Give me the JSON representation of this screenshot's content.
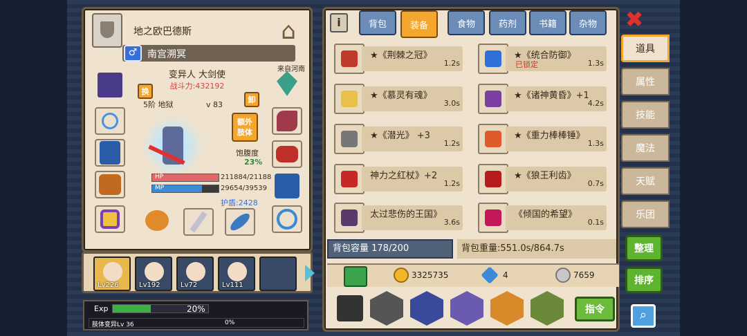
{
  "character": {
    "guild_name": "地之欧巴德斯",
    "gender_symbol": "♂",
    "name": "南宫溯冥",
    "origin": "来自河南",
    "class_line": "变异人 大剑使",
    "power_label": "战斗力:",
    "power_value": "432192",
    "swap_button": "换",
    "unequip_button": "卸",
    "extra_limb_button": "额外\n肢体",
    "stage_text": "5阶 地狱",
    "level_text": "v 83",
    "hunger_label": "饱腹度",
    "hunger_value": "23%",
    "hp_label": "HP",
    "hp_value": "211884/21188",
    "hp_fill": 1.0,
    "mp_label": "MP",
    "mp_value": "29654/39539",
    "mp_fill": 0.75,
    "shield_text": "护盾:2428"
  },
  "party": [
    {
      "level": "Lv226",
      "selected": true
    },
    {
      "level": "Lv192",
      "selected": false
    },
    {
      "level": "Lv72",
      "selected": false
    },
    {
      "level": "Lv111",
      "selected": false
    },
    {
      "level": "",
      "selected": false
    }
  ],
  "exp": {
    "label": "Exp",
    "percent": "20%",
    "fill": 0.4,
    "sub_label": "肢体变异Lv 36",
    "sub_percent": "0%"
  },
  "bag": {
    "info_label": "i",
    "tabs": [
      "背包",
      "装备",
      "食物",
      "药剂",
      "书籍",
      "杂物"
    ],
    "active_tab": "装备",
    "items": [
      {
        "name": "★《荆棘之冠》",
        "time": "1.2s",
        "lock": "",
        "color": "#c0392b"
      },
      {
        "name": "★《统合防御》",
        "time": "1.3s",
        "lock": "已锁定",
        "color": "#2e6fd8"
      },
      {
        "name": "★《慕灵有魂》",
        "time": "3.0s",
        "lock": "",
        "color": "#e8c04a"
      },
      {
        "name": "★《诸神黄昏》+1",
        "time": "4.2s",
        "lock": "",
        "color": "#7b3fa0"
      },
      {
        "name": "★《潜光》 +3",
        "time": "1.2s",
        "lock": "",
        "color": "#777777"
      },
      {
        "name": "★《重力棒棒锤》",
        "time": "1.3s",
        "lock": "",
        "color": "#e05a2a"
      },
      {
        "name": "神力之红杖》+2",
        "time": "1.2s",
        "lock": "",
        "color": "#c62828"
      },
      {
        "name": "★《狼王利齿》",
        "time": "0.7s",
        "lock": "",
        "color": "#b71c1c"
      },
      {
        "name": "太过悲伤的王国》",
        "time": "3.6s",
        "lock": "",
        "color": "#5a3a6a"
      },
      {
        "name": "《倾国的希望》",
        "time": "0.1s",
        "lock": "",
        "color": "#c2185b"
      }
    ],
    "capacity": "背包容量 178/200",
    "weight": "背包重量:551.0s/864.7s",
    "gold": "3325735",
    "gems": "4",
    "silver": "7659",
    "command_button": "指令"
  },
  "side_nav": {
    "close": "✖",
    "tabs": [
      "道具",
      "属性",
      "技能",
      "魔法",
      "天赋",
      "乐团"
    ],
    "active": "道具",
    "sort_button": "整理",
    "order_button": "排序",
    "search_icon": "search-icon"
  }
}
